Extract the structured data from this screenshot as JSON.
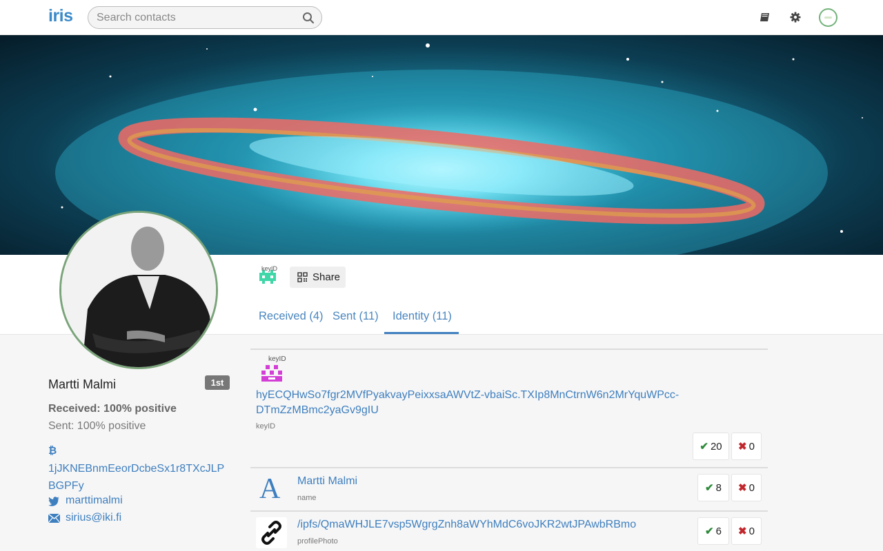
{
  "header": {
    "logo": "iris",
    "search_placeholder": "Search contacts",
    "icons": [
      "search-icon",
      "book-icon",
      "gear-icon",
      "user-avatar"
    ]
  },
  "profile": {
    "name": "Martti Malmi",
    "degree": "1st",
    "received": "Received: 100% positive",
    "sent": "Sent: 100% positive",
    "bitcoin_symbol": "₿",
    "bitcoin_address": "1jJKNEBnmEeorDcbeSx1r8TXcJLPBGPFy",
    "twitter": "marttimalmi",
    "email": "sirius@iki.fi"
  },
  "actions": {
    "keyid_label": "keyID",
    "share_label": "Share"
  },
  "tabs": [
    {
      "label": "Received (4)",
      "active": false
    },
    {
      "label": "Sent (11)",
      "active": false
    },
    {
      "label": "Identity (11)",
      "active": true
    }
  ],
  "identities": [
    {
      "badge_label": "keyID",
      "value": "hyECQHwSo7fgr2MVfPyakvayPeixxsaAWVtZ-vbaiSc.TXIp8MnCtrnW6n2MrYquWPcc-DTmZzMBmc2yaGv9gIU",
      "type": "keyID",
      "up": "20",
      "down": "0"
    },
    {
      "icon_letter": "A",
      "value": "Martti Malmi",
      "type": "name",
      "up": "8",
      "down": "0"
    },
    {
      "value": "/ipfs/QmaWHJLE7vsp5WgrgZnh8aWYhMdC6voJKR2wtJPAwbRBmo",
      "type": "profilePhoto",
      "up": "6",
      "down": "0"
    }
  ],
  "colors": {
    "accent": "#3e7fbf",
    "logo": "#3b8ac9",
    "upvote": "#2e8a3a",
    "downvote": "#c0272d",
    "photo_border": "#7aa47a"
  }
}
